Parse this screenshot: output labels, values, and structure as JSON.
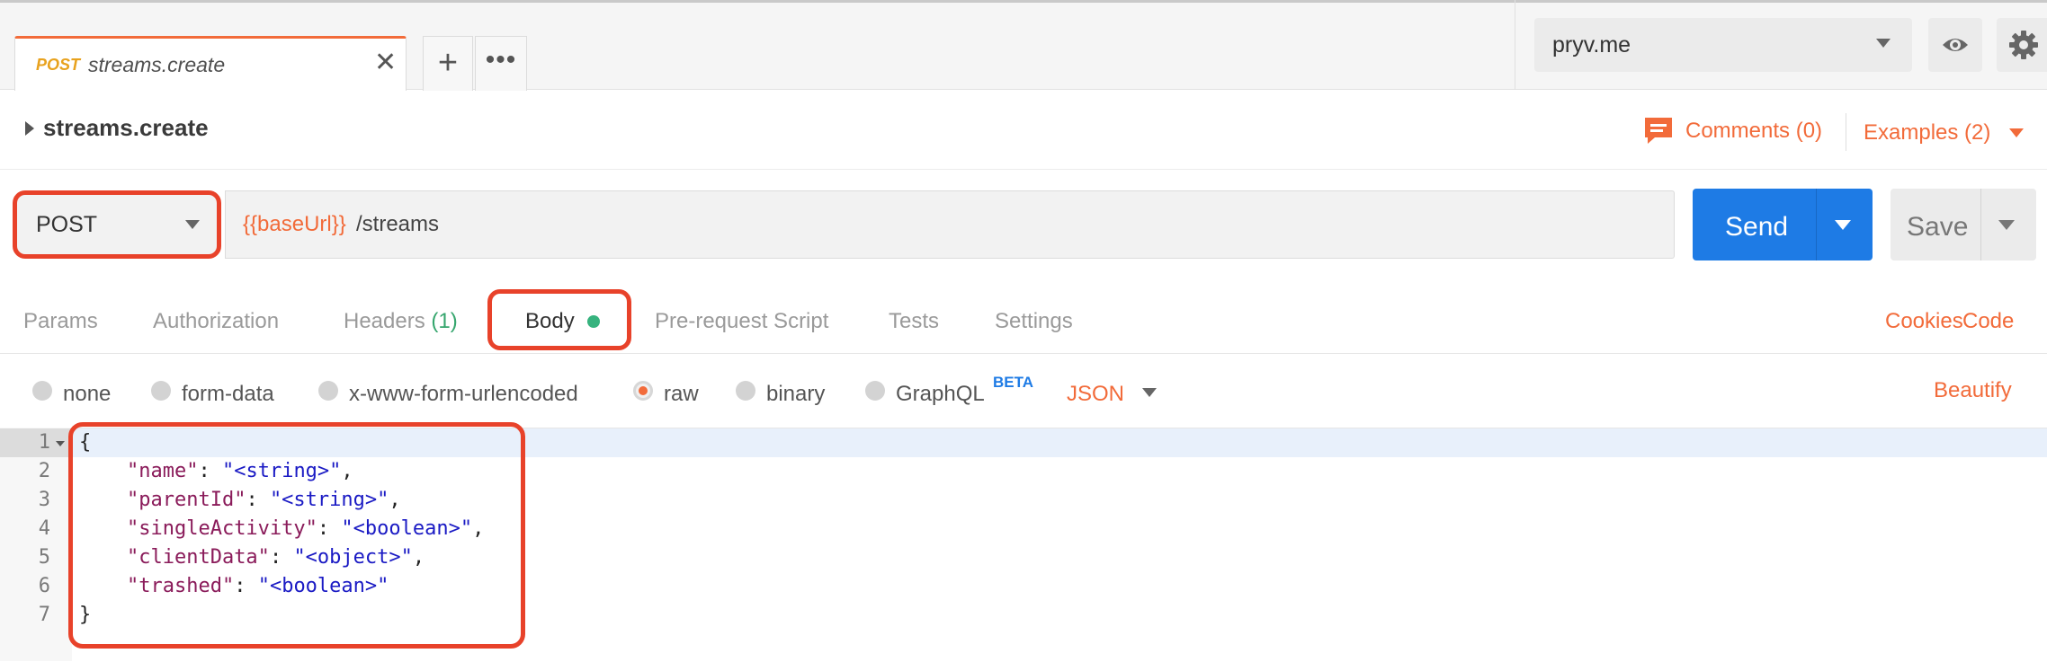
{
  "tabs": {
    "active": {
      "method": "POST",
      "name": "streams.create"
    },
    "close_glyph": "✕",
    "add_glyph": "+",
    "more_glyph": "•••"
  },
  "environment": {
    "selected": "pryv.me"
  },
  "icons": {
    "eye": "eye-icon",
    "gear": "gear-icon",
    "comments": "comment-icon"
  },
  "request": {
    "name": "streams.create",
    "comments_label": "Comments (0)",
    "examples_label": "Examples (2)",
    "method": "POST",
    "url_variable": "{{baseUrl}}",
    "url_path": "/streams",
    "send_label": "Send",
    "save_label": "Save"
  },
  "request_tabs": {
    "params": "Params",
    "authorization": "Authorization",
    "headers": "Headers",
    "headers_count": "(1)",
    "body": "Body",
    "prerequest": "Pre-request Script",
    "tests": "Tests",
    "settings": "Settings",
    "cookies": "Cookies",
    "code": "Code"
  },
  "body_modes": {
    "none": "none",
    "form_data": "form-data",
    "urlencoded": "x-www-form-urlencoded",
    "raw": "raw",
    "binary": "binary",
    "graphql": "GraphQL",
    "beta": "BETA",
    "selected": "raw",
    "format": "JSON",
    "beautify": "Beautify"
  },
  "editor": {
    "line_numbers": [
      "1",
      "2",
      "3",
      "4",
      "5",
      "6",
      "7"
    ],
    "lines": [
      {
        "open": "{"
      },
      {
        "key": "\"name\"",
        "value": "\"<string>\"",
        "trail": ","
      },
      {
        "key": "\"parentId\"",
        "value": "\"<string>\"",
        "trail": ","
      },
      {
        "key": "\"singleActivity\"",
        "value": "\"<boolean>\"",
        "trail": ","
      },
      {
        "key": "\"clientData\"",
        "value": "\"<object>\"",
        "trail": ","
      },
      {
        "key": "\"trashed\"",
        "value": "\"<boolean>\"",
        "trail": ""
      },
      {
        "close": "}"
      }
    ],
    "colon": ": "
  },
  "colors": {
    "accent": "#f26b3a",
    "send": "#1e7be5",
    "highlight": "#e8422a",
    "method_tab": "#e8a21e"
  }
}
